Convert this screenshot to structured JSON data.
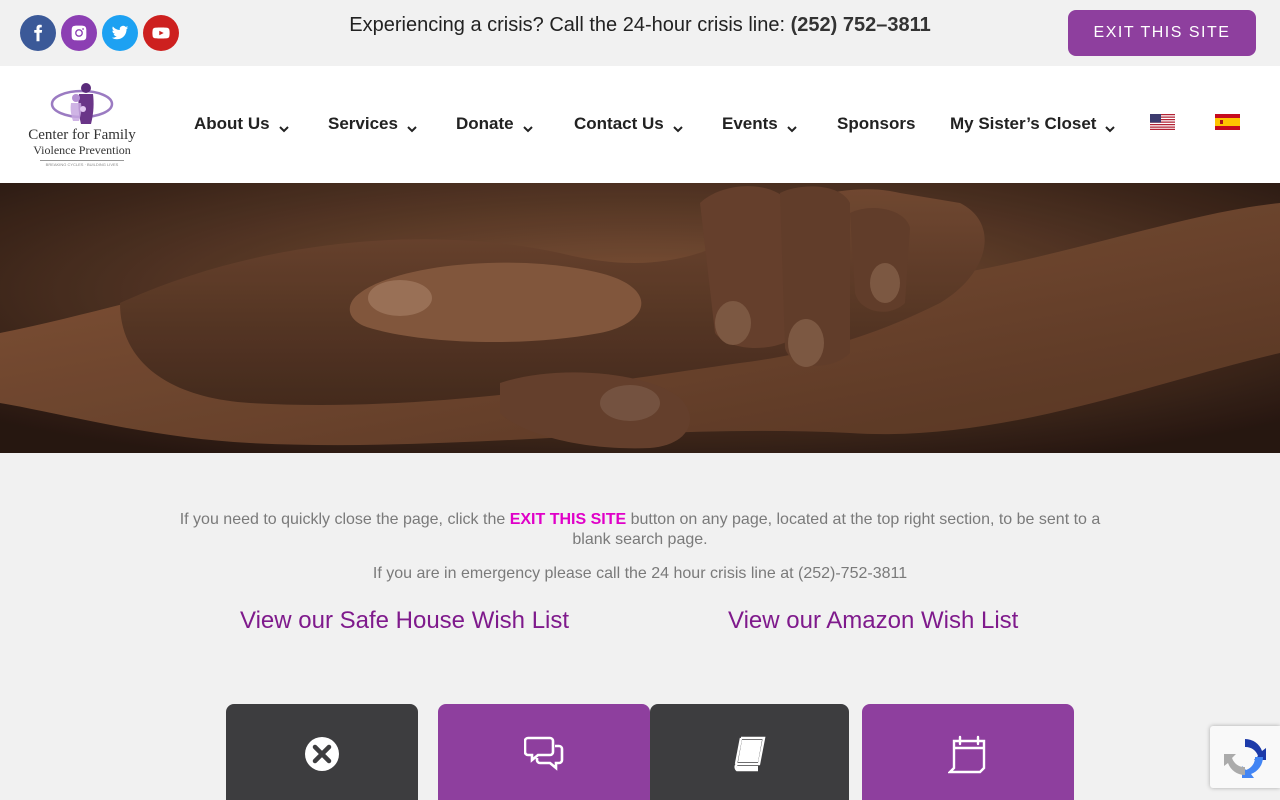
{
  "topbar": {
    "social": [
      "facebook-icon",
      "instagram-icon",
      "twitter-icon",
      "youtube-icon"
    ],
    "crisis_text": "Experiencing a crisis? Call the 24-hour crisis line: ",
    "crisis_phone": "(252) 752–3811",
    "exit_label": "EXIT THIS SITE"
  },
  "logo": {
    "line1": "Center for Family",
    "line2": "Violence Prevention",
    "tagline": "BREAKING CYCLES · BUILDING LIVES"
  },
  "nav": {
    "items": [
      {
        "label": "About Us",
        "dropdown": true
      },
      {
        "label": "Services",
        "dropdown": true
      },
      {
        "label": "Donate",
        "dropdown": true
      },
      {
        "label": "Contact Us",
        "dropdown": true
      },
      {
        "label": "Events",
        "dropdown": true
      },
      {
        "label": "Sponsors",
        "dropdown": false
      },
      {
        "label": "My Sister’s Closet",
        "dropdown": true
      }
    ],
    "languages": [
      "us-flag-icon",
      "spain-flag-icon"
    ]
  },
  "content": {
    "exit_text_before": "If you need to quickly close the page, click the ",
    "exit_text_highlight": "EXIT THIS SITE",
    "exit_text_after": " button on any page, located at the top right section, to be sent to a blank search page.",
    "emergency_text": "If you are in emergency please call the 24 hour crisis line at (252)-752-3811",
    "wishlist_safe_house": "View our Safe House Wish List",
    "wishlist_amazon": "View our Amazon Wish List"
  },
  "cards": [
    {
      "icon": "close-circle-icon"
    },
    {
      "icon": "chat-bubbles-icon"
    },
    {
      "icon": "book-icon"
    },
    {
      "icon": "calendar-icon"
    }
  ],
  "colors": {
    "accent_purple": "#8e3f9e",
    "link_purple": "#7f1a8c",
    "highlight_magenta": "#e000c8",
    "dark_card": "#3d3d3f"
  }
}
